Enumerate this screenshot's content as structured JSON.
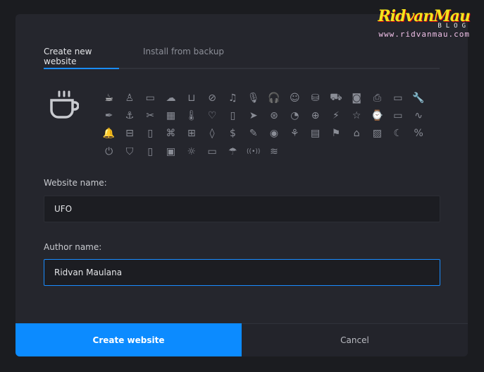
{
  "tabs": [
    {
      "label": "Create new website"
    },
    {
      "label": "Install from backup"
    }
  ],
  "selected_icon": "coffee-cup",
  "icons": [
    "☕",
    "♙",
    "▭",
    "☁",
    "⊔",
    "⊘",
    "♫",
    "🎙",
    "🎧",
    "☺",
    "⛁",
    "⛟",
    "◙",
    "⎙",
    "▭",
    "🔧",
    "✒",
    "⚓",
    "✂",
    "▦",
    "🌡",
    "♡",
    "▯",
    "➤",
    "⊛",
    "◔",
    "⊕",
    "⚡",
    "☆",
    "⌚",
    "▭",
    "∿",
    "🔔",
    "⊟",
    "▯",
    "⌘",
    "⊞",
    "◊",
    "$",
    "✎",
    "◉",
    "⚘",
    "▤",
    "⚑",
    "⌂",
    "▨",
    "☾",
    "%",
    "⏻",
    "⛉",
    "▯",
    "▣",
    "☼",
    "▭",
    "☂",
    "((•))",
    "≋"
  ],
  "fields": {
    "website_name": {
      "label": "Website name:",
      "value": "UFO"
    },
    "author_name": {
      "label": "Author name:",
      "value": "Ridvan Maulana"
    }
  },
  "buttons": {
    "create": "Create website",
    "cancel": "Cancel"
  },
  "watermark": {
    "brand": "RidvanMau",
    "sub": "BLOG",
    "url": "www.ridvanmau.com"
  },
  "colors": {
    "accent": "#0c8bff",
    "dialog_bg": "#25262d",
    "page_bg": "#1b1c20"
  }
}
